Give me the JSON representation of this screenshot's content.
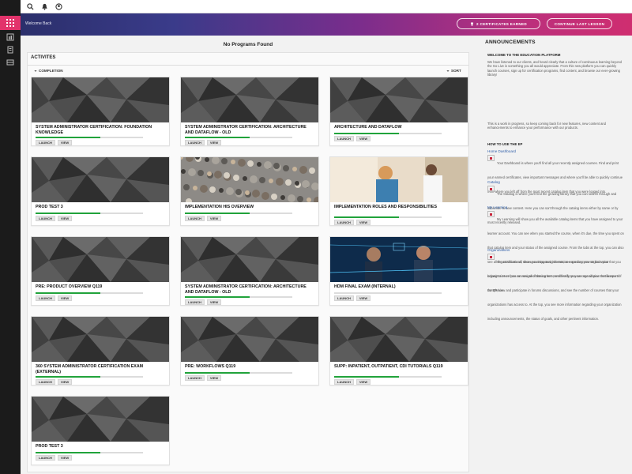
{
  "header": {
    "welcome": "Welcome Back",
    "certificates_label": "2  CERTIFICATES EARNED",
    "continue_label": "CONTINUE LAST LESSON"
  },
  "main": {
    "no_programs": "No Programs Found",
    "activities_title": "ACTIVITES",
    "completion_label": "COMPLETION",
    "sort_label": "SORT",
    "cards": [
      {
        "title": "SYSTEM ADMINISTRATOR CERTIFICATION: FOUNDATION KNOWLEDGE",
        "progress": 0.6,
        "launch": "LAUNCH",
        "view": "VIEW",
        "thumb": "polygon-dark"
      },
      {
        "title": "SYSTEM ADMINISTRATOR CERTIFICATION: ARCHITECTURE AND DATAFLOW - OLD",
        "progress": 0.6,
        "launch": "LAUNCH",
        "view": "VIEW",
        "thumb": "polygon-dark"
      },
      {
        "title": "ARCHITECTURE AND DATAFLOW",
        "progress": 0.6,
        "launch": "LAUNCH",
        "view": "VIEW",
        "thumb": "polygon-dark"
      },
      {
        "title": "PROD TEST 3",
        "progress": 0.6,
        "launch": "LAUNCH",
        "view": "VIEW",
        "thumb": "polygon-dark"
      },
      {
        "title": "IMPLEMENTATION HIS OVERVIEW",
        "progress": 0.6,
        "launch": "LAUNCH",
        "view": "VIEW",
        "thumb": "crowd-photo"
      },
      {
        "title": "IMPLEMENTATION ROLES AND RESPONSIBILITIES",
        "progress": 0.6,
        "launch": "LAUNCH",
        "view": "VIEW",
        "thumb": "clinic-photo"
      },
      {
        "title": "PRE: PRODUCT OVERVIEW Q119",
        "progress": 0.6,
        "launch": "LAUNCH",
        "view": "VIEW",
        "thumb": "polygon-dark"
      },
      {
        "title": "SYSTEM ADMINISTRATOR CERTIFICATION: ARCHITECTURE AND DATAFLOW - OLD",
        "progress": 0.6,
        "launch": "LAUNCH",
        "view": "VIEW",
        "thumb": "polygon-dark"
      },
      {
        "title": "HDM FINAL EXAM (INTERNAL)",
        "progress": 0.0,
        "launch": "LAUNCH",
        "view": "VIEW",
        "thumb": "tech-photo"
      },
      {
        "title": "360 SYSTEM ADMINISTRATOR CERTIFICATION EXAM (EXTERNAL)",
        "progress": 0.6,
        "launch": "LAUNCH",
        "view": "VIEW",
        "thumb": "polygon-dark"
      },
      {
        "title": "PRE: WORKFLOWS Q119",
        "progress": 0.6,
        "launch": "LAUNCH",
        "view": "VIEW",
        "thumb": "polygon-dark"
      },
      {
        "title": "SUPP: INPATIENT, OUTPATIENT, CDI TUTORIALS Q119",
        "progress": 0.6,
        "launch": "LAUNCH",
        "view": "VIEW",
        "thumb": "polygon-dark"
      },
      {
        "title": "PROD TEST 3",
        "progress": 0.6,
        "launch": "LAUNCH",
        "view": "VIEW",
        "thumb": "polygon-dark"
      }
    ]
  },
  "announcements": {
    "title": "ANNOUNCEMENTS",
    "welcome_heading": "WELCOME TO THE EDUCATION PLATFORM",
    "intro": "We have listened to our clients, and heard clearly that a culture of continuous learning beyond the Go Live is something you all would appreciate. From this new platform you can quickly launch courses, sign up for certification programs, find content, and browse our ever-growing library!",
    "note": "This is a work in progress, so keep coming back for new features, new content and enhancements to enhance your performance with our products.",
    "howto": "HOW TO USE THE EP",
    "sections": [
      {
        "heading": "Home Dashboard",
        "text": "Your Dashboard is where you'll find all your recently assigned courses. Find and print your earned certificates, view important messages and where you'll be able to quickly continue from where you left off from the most recent catalog item that you were logged into."
      },
      {
        "heading": "Catalog",
        "text": "The Catalog is where you'll find the growing library that you can search through and subscribe to new content. Here you can sort through the catalog items either by name or by most recently released."
      },
      {
        "heading": "My Learning",
        "text": "My Learning will show you all the available catalog items that you have assigned to your learner account. You can see when you started the course, when it's due, the time you spent on that catalog item and your status of the assigned course. From the tabs at the top, you can also see all the certifications, view upcoming assignments, see announcements from your organization or from an assigned catalog item, and finally, you can see all your certificates of completion."
      },
      {
        "heading": "Organizations",
        "text": "Organizations will show you important information regarding your organization that you belong to. Here you can see all of the current members from your organization that are part of the EP, view and participate in forums discussions, and see the number of courses that your organizations has access to. At the top, you see more information regarding your organization including announcements, the status of goals, and other pertinent information."
      }
    ]
  },
  "colors": {
    "progress": "#21a33b",
    "app_button": "#e2336b",
    "link": "#2f5ea8"
  }
}
